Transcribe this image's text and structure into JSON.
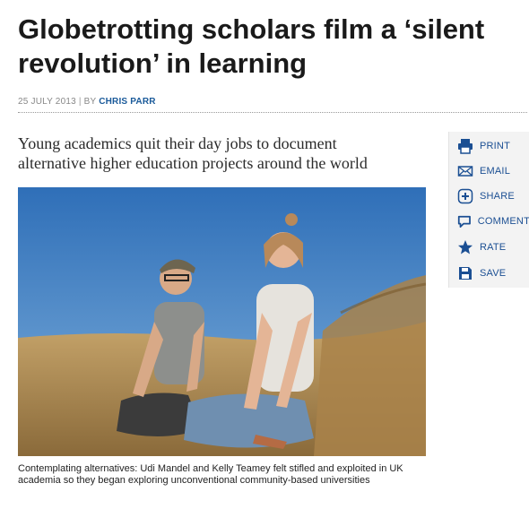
{
  "article": {
    "headline_line1": "Globetrotting scholars film a ‘silent",
    "headline_line2": "revolution’ in learning",
    "date": "25 JULY 2013",
    "separator": "|",
    "by_prefix": "BY",
    "author": "CHRIS PARR",
    "standfirst_line1": "Young academics quit their day jobs to document",
    "standfirst_line2": "alternative higher education projects around the world",
    "caption": "Contemplating alternatives: Udi Mandel and Kelly Teamey felt stifled and exploited in UK academia so they began exploring unconventional community-based universities"
  },
  "tools": {
    "items": [
      {
        "label": "PRINT",
        "icon": "print-icon"
      },
      {
        "label": "EMAIL",
        "icon": "email-icon"
      },
      {
        "label": "SHARE",
        "icon": "share-icon"
      },
      {
        "label": "COMMENT",
        "icon": "comment-icon"
      },
      {
        "label": "RATE",
        "icon": "star-icon"
      },
      {
        "label": "SAVE",
        "icon": "save-icon"
      }
    ]
  },
  "colors": {
    "link_blue": "#1b4f93",
    "author_blue": "#1a5a9a",
    "sky": "#3a7fc4",
    "grass": "#b89458"
  }
}
